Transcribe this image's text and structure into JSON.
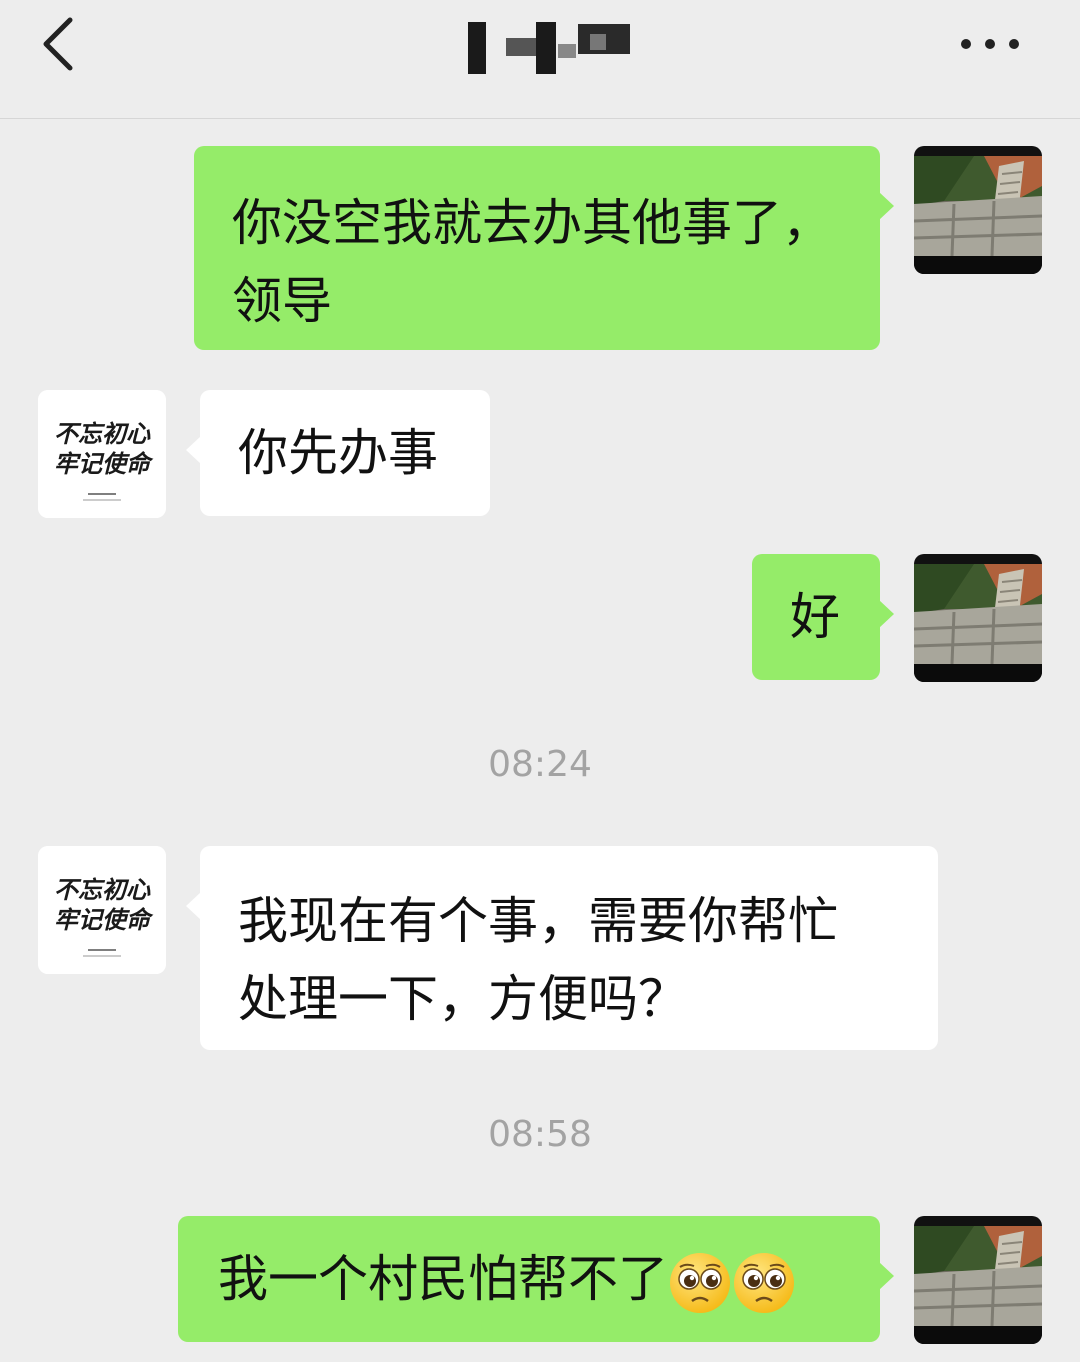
{
  "header": {
    "back_icon": "chevron-left-icon",
    "title_redacted": true,
    "more_icon": "more-dots-icon"
  },
  "messages": [
    {
      "side": "me",
      "text": "你没空我就去办其他事了，领导",
      "line1": "你没空我就去办其他事了，",
      "line2": "领导"
    },
    {
      "side": "other",
      "text": "你先办事"
    },
    {
      "side": "me",
      "text": "好"
    },
    {
      "type": "time",
      "text": "08:24"
    },
    {
      "side": "other",
      "text": "我现在有个事，需要你帮忙处理一下，方便吗？",
      "line1": "我现在有个事，需要你帮忙",
      "line2": "处理一下，方便吗？"
    },
    {
      "type": "time",
      "text": "08:58"
    },
    {
      "side": "me",
      "text": "我一个村民怕帮不了",
      "emojis": [
        "pleading-face-icon",
        "pleading-face-icon"
      ]
    }
  ],
  "colors": {
    "background": "#ededed",
    "my_bubble": "#95ec69",
    "other_bubble": "#ffffff",
    "timestamp": "#a3a3a3"
  },
  "avatars": {
    "me": "stone-path-photo",
    "other": "calligraphy-avatar"
  },
  "avatar_text": {
    "line1": "不忘初心",
    "line2": "牢记使命"
  }
}
